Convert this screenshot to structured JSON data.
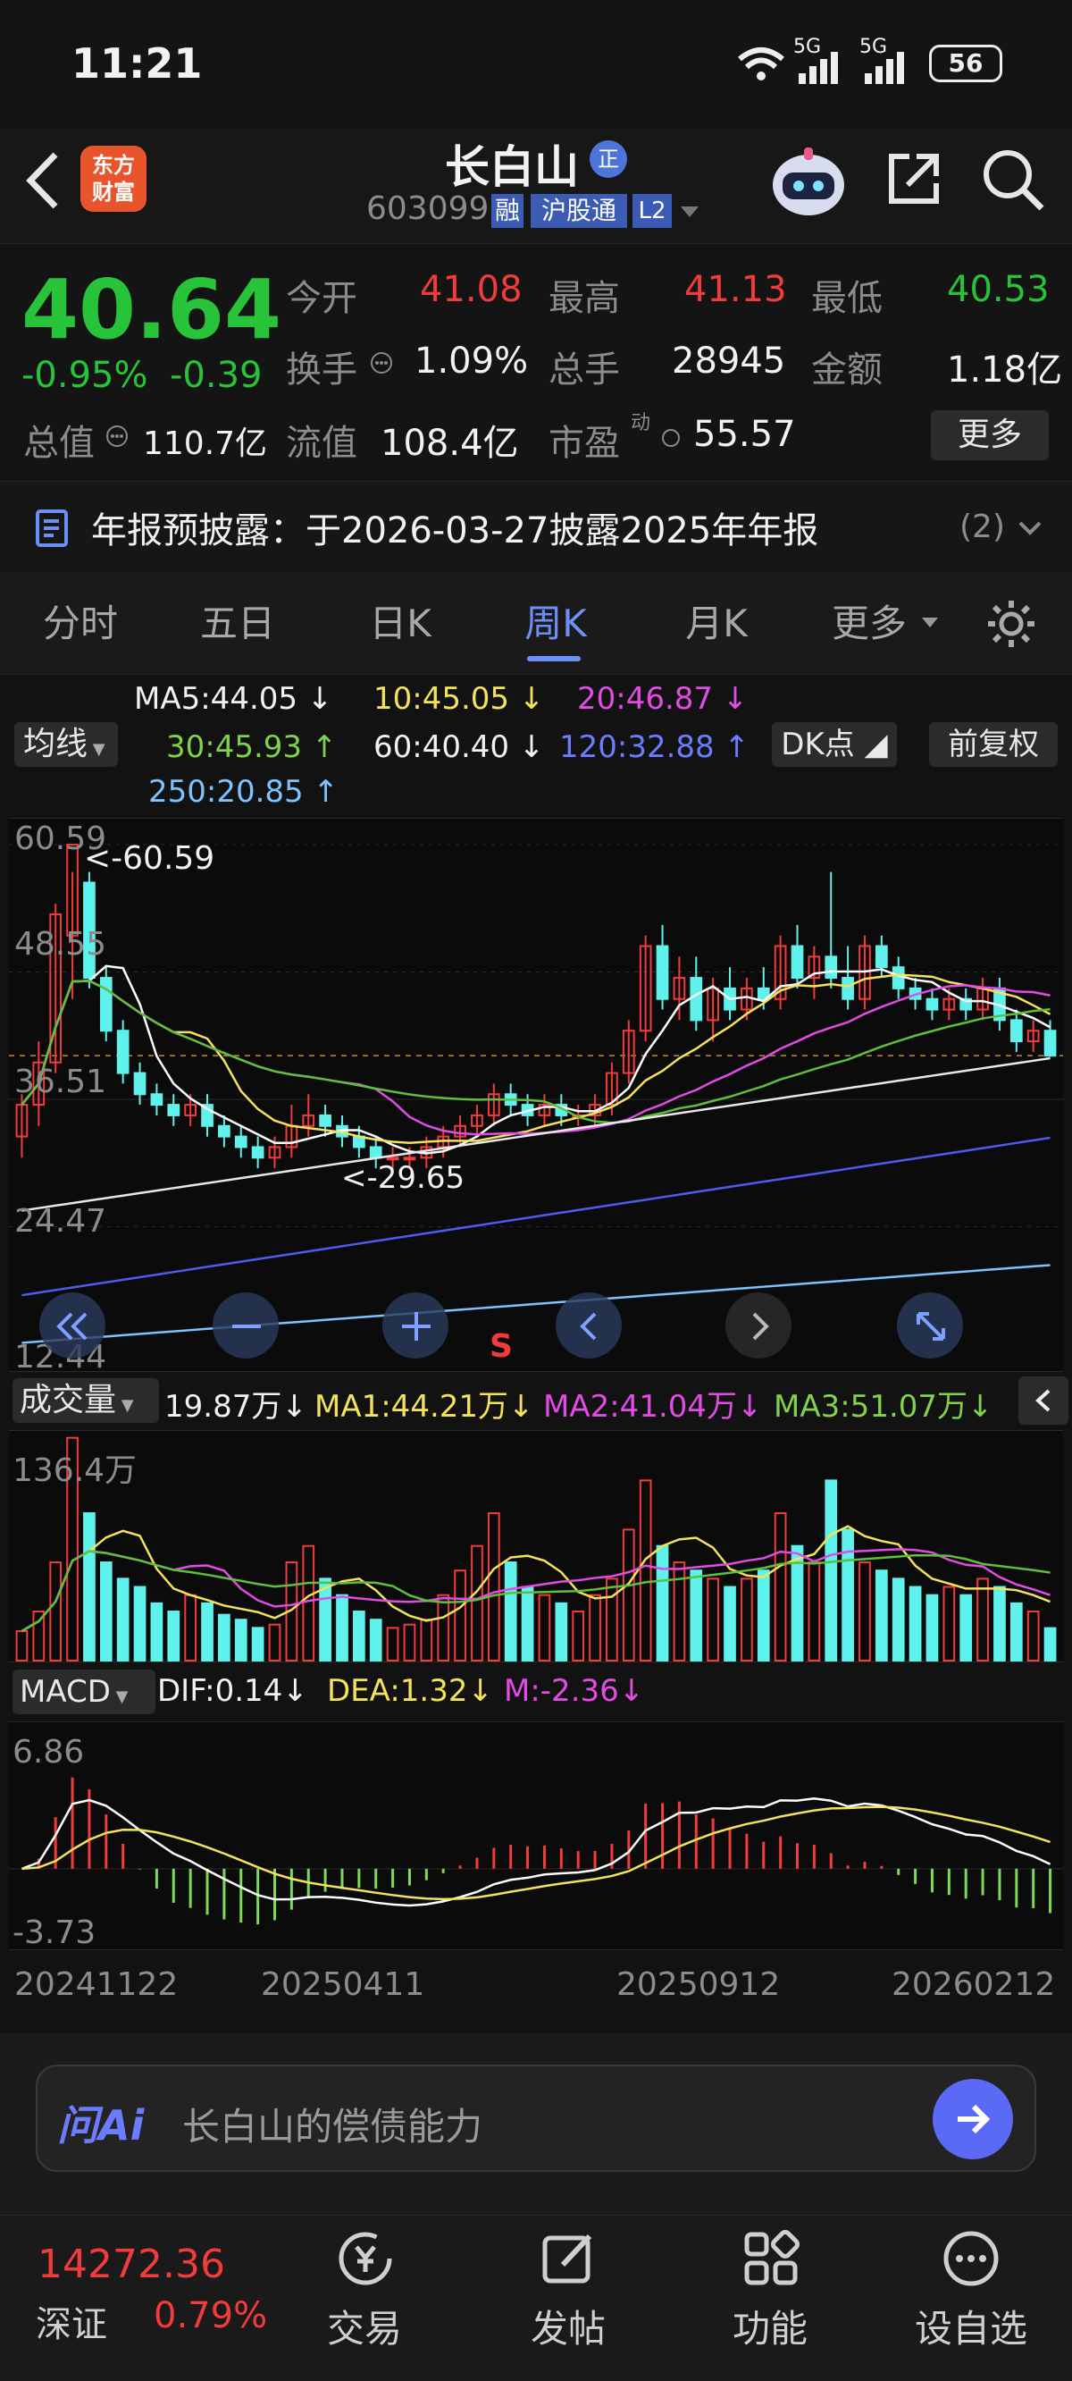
{
  "status": {
    "time": "11:21",
    "signal1": "5G",
    "signal2": "5G",
    "battery": "56"
  },
  "header": {
    "logo_text": [
      "东方",
      "财富"
    ],
    "name": "长白山",
    "name_badge": "正",
    "code": "603099",
    "tags": [
      "融",
      "沪股通",
      "L2"
    ]
  },
  "quote": {
    "price": "40.64",
    "pct": "-0.95%",
    "chg": "-0.39",
    "open_label": "今开",
    "open": "41.08",
    "high_label": "最高",
    "high": "41.13",
    "low_label": "最低",
    "low": "40.53",
    "turnover_label": "换手",
    "turnover": "1.09%",
    "volume_label": "总手",
    "volume": "28945",
    "amount_label": "金额",
    "amount": "1.18亿",
    "mcap_label": "总值",
    "mcap": "110.7亿",
    "float_label": "流值",
    "float": "108.4亿",
    "pe_label": "市盈",
    "pe_sup": "动",
    "pe": "55.57",
    "more": "更多"
  },
  "notice": {
    "text": "年报预披露：于2026-03-27披露2025年年报",
    "count": "(2)"
  },
  "tabs": [
    "分时",
    "五日",
    "日K",
    "周K",
    "月K",
    "更多"
  ],
  "active_tab": 3,
  "ma": {
    "selector": "均线",
    "ma5": "MA5:44.05 ↓",
    "ma10": "10:45.05 ↓",
    "ma20": "20:46.87 ↓",
    "ma30": "30:45.93 ↑",
    "ma60": "60:40.40 ↓",
    "ma120": "120:32.88 ↑",
    "ma250": "250:20.85 ↑",
    "dk": "DK点",
    "adjust": "前复权"
  },
  "kline": {
    "y_labels": [
      "60.59",
      "48.55",
      "36.51",
      "24.47",
      "12.44"
    ],
    "max_note": "<-60.59",
    "min_note": "<-29.65",
    "s_mark": "S"
  },
  "volume": {
    "selector": "成交量",
    "value": "19.87万↓",
    "ma1": "MA1:44.21万↓",
    "ma2": "MA2:41.04万↓",
    "ma3": "MA3:51.07万↓",
    "max_label": "136.4万"
  },
  "macd": {
    "selector": "MACD",
    "dif": "DIF:0.14↓",
    "dea": "DEA:1.32↓",
    "m": "M:-2.36↓",
    "top": "6.86",
    "bottom": "-3.73"
  },
  "dates": [
    "20241122",
    "20250411",
    "20250912",
    "20260212"
  ],
  "ai": {
    "placeholder": "长白山的偿债能力",
    "logo": "问Ai"
  },
  "nav": {
    "index_value": "14272.36",
    "index_name": "深证",
    "index_pct": "0.79%",
    "items": [
      "交易",
      "发帖",
      "功能",
      "设自选"
    ]
  },
  "colors": {
    "up": "#f23b3b",
    "down": "#5ff2ec",
    "green": "#27c43a",
    "ma5": "#ffffff",
    "ma10": "#f5e25b",
    "ma20": "#e24be4",
    "ma30": "#5fbf3a",
    "ma60": "#ffffff",
    "ma120": "#4d5cf0",
    "ma250": "#7dc3ff"
  },
  "chart_data": {
    "type": "candlestick",
    "period": "weekly",
    "x_range": [
      "20241122",
      "20260212"
    ],
    "ylim": [
      12.44,
      60.59
    ],
    "y_ticks": [
      60.59,
      48.55,
      36.51,
      24.47,
      12.44
    ],
    "high_mark": 60.59,
    "low_mark": 29.65,
    "candles": [
      {
        "o": 33,
        "h": 37,
        "l": 31,
        "c": 36
      },
      {
        "o": 36,
        "h": 42,
        "l": 34,
        "c": 40
      },
      {
        "o": 40,
        "h": 55,
        "l": 39,
        "c": 54
      },
      {
        "o": 52,
        "h": 58,
        "l": 46,
        "c": 60.59
      },
      {
        "o": 57,
        "h": 58,
        "l": 47,
        "c": 48
      },
      {
        "o": 48,
        "h": 49,
        "l": 42,
        "c": 43
      },
      {
        "o": 43,
        "h": 44,
        "l": 38,
        "c": 39
      },
      {
        "o": 39,
        "h": 40,
        "l": 36,
        "c": 37
      },
      {
        "o": 37,
        "h": 38,
        "l": 35,
        "c": 36
      },
      {
        "o": 36,
        "h": 37,
        "l": 34,
        "c": 35
      },
      {
        "o": 35,
        "h": 37,
        "l": 34,
        "c": 36
      },
      {
        "o": 36,
        "h": 37,
        "l": 33,
        "c": 34
      },
      {
        "o": 34,
        "h": 35,
        "l": 32,
        "c": 33
      },
      {
        "o": 33,
        "h": 34,
        "l": 31,
        "c": 32
      },
      {
        "o": 32,
        "h": 33,
        "l": 30,
        "c": 31
      },
      {
        "o": 31,
        "h": 33,
        "l": 30,
        "c": 32
      },
      {
        "o": 32,
        "h": 36,
        "l": 31,
        "c": 34
      },
      {
        "o": 34,
        "h": 37,
        "l": 33,
        "c": 35
      },
      {
        "o": 35,
        "h": 36,
        "l": 33,
        "c": 34
      },
      {
        "o": 34,
        "h": 35,
        "l": 32,
        "c": 33
      },
      {
        "o": 33,
        "h": 34,
        "l": 31,
        "c": 32
      },
      {
        "o": 32,
        "h": 33,
        "l": 30,
        "c": 31
      },
      {
        "o": 31,
        "h": 32,
        "l": 29.65,
        "c": 31
      },
      {
        "o": 31,
        "h": 32,
        "l": 30,
        "c": 31
      },
      {
        "o": 31,
        "h": 33,
        "l": 30,
        "c": 32
      },
      {
        "o": 32,
        "h": 34,
        "l": 31,
        "c": 33
      },
      {
        "o": 33,
        "h": 35,
        "l": 32,
        "c": 34
      },
      {
        "o": 34,
        "h": 36,
        "l": 33,
        "c": 35
      },
      {
        "o": 35,
        "h": 38,
        "l": 34,
        "c": 37
      },
      {
        "o": 37,
        "h": 38,
        "l": 35,
        "c": 36
      },
      {
        "o": 36,
        "h": 37,
        "l": 34,
        "c": 35
      },
      {
        "o": 35,
        "h": 37,
        "l": 34,
        "c": 36
      },
      {
        "o": 36,
        "h": 37,
        "l": 34,
        "c": 35
      },
      {
        "o": 35,
        "h": 36,
        "l": 34,
        "c": 35
      },
      {
        "o": 35,
        "h": 37,
        "l": 34,
        "c": 36
      },
      {
        "o": 36,
        "h": 40,
        "l": 35,
        "c": 39
      },
      {
        "o": 39,
        "h": 44,
        "l": 38,
        "c": 43
      },
      {
        "o": 43,
        "h": 52,
        "l": 42,
        "c": 51
      },
      {
        "o": 51,
        "h": 53,
        "l": 45,
        "c": 46
      },
      {
        "o": 46,
        "h": 50,
        "l": 44,
        "c": 48
      },
      {
        "o": 48,
        "h": 50,
        "l": 43,
        "c": 44
      },
      {
        "o": 44,
        "h": 48,
        "l": 42,
        "c": 47
      },
      {
        "o": 47,
        "h": 49,
        "l": 44,
        "c": 45
      },
      {
        "o": 45,
        "h": 48,
        "l": 44,
        "c": 47
      },
      {
        "o": 47,
        "h": 49,
        "l": 45,
        "c": 46
      },
      {
        "o": 46,
        "h": 52,
        "l": 45,
        "c": 51
      },
      {
        "o": 51,
        "h": 53,
        "l": 47,
        "c": 48
      },
      {
        "o": 48,
        "h": 51,
        "l": 46,
        "c": 50
      },
      {
        "o": 50,
        "h": 58,
        "l": 47,
        "c": 48
      },
      {
        "o": 48,
        "h": 51,
        "l": 45,
        "c": 46
      },
      {
        "o": 46,
        "h": 52,
        "l": 45,
        "c": 51
      },
      {
        "o": 51,
        "h": 52,
        "l": 48,
        "c": 49
      },
      {
        "o": 49,
        "h": 50,
        "l": 46,
        "c": 47
      },
      {
        "o": 47,
        "h": 48,
        "l": 45,
        "c": 46
      },
      {
        "o": 46,
        "h": 47,
        "l": 44,
        "c": 45
      },
      {
        "o": 45,
        "h": 47,
        "l": 44,
        "c": 46
      },
      {
        "o": 46,
        "h": 47,
        "l": 44,
        "c": 45
      },
      {
        "o": 45,
        "h": 48,
        "l": 44,
        "c": 47
      },
      {
        "o": 47,
        "h": 48,
        "l": 43,
        "c": 44
      },
      {
        "o": 44,
        "h": 45,
        "l": 41,
        "c": 42
      },
      {
        "o": 42,
        "h": 44,
        "l": 41,
        "c": 43
      },
      {
        "o": 43,
        "h": 44,
        "l": 40.53,
        "c": 40.64
      }
    ],
    "volume_max": 136.4,
    "volume": [
      18,
      30,
      60,
      136,
      90,
      60,
      50,
      45,
      35,
      30,
      40,
      35,
      28,
      25,
      20,
      22,
      60,
      70,
      50,
      40,
      30,
      25,
      20,
      22,
      25,
      40,
      55,
      70,
      90,
      60,
      45,
      40,
      35,
      30,
      40,
      50,
      80,
      110,
      70,
      60,
      55,
      50,
      45,
      50,
      55,
      90,
      70,
      60,
      110,
      80,
      60,
      55,
      50,
      45,
      40,
      45,
      40,
      50,
      45,
      35,
      30,
      19.87
    ],
    "macd_range": [
      -3.73,
      6.86
    ]
  }
}
